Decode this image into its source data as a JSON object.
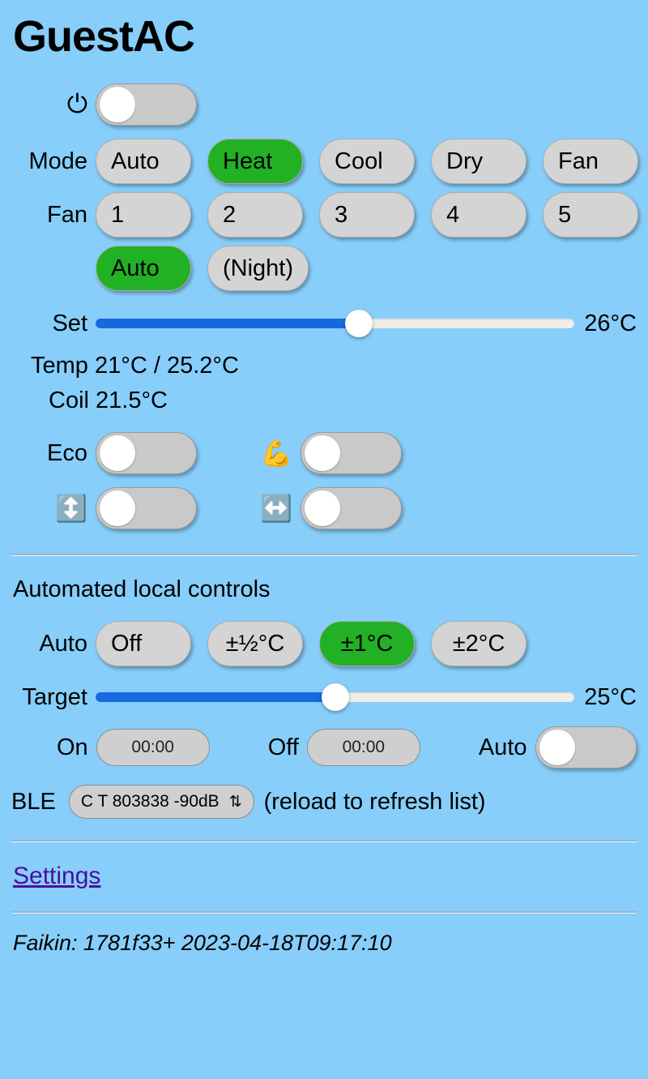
{
  "app": {
    "title": "GuestAC"
  },
  "power": {
    "icon": "power-icon",
    "glyph": "⏻",
    "state": "off"
  },
  "mode": {
    "label": "Mode",
    "options": [
      "Auto",
      "Heat",
      "Cool",
      "Dry",
      "Fan"
    ],
    "selected": "Heat"
  },
  "fan": {
    "label": "Fan",
    "speeds": [
      "1",
      "2",
      "3",
      "4",
      "5"
    ],
    "extra": [
      "Auto",
      "(Night)"
    ],
    "selected": "Auto"
  },
  "set_slider": {
    "label": "Set",
    "value": "26°C",
    "percent": 55
  },
  "readouts": {
    "temp": "Temp 21°C / 25.2°C",
    "coil": "Coil 21.5°C"
  },
  "toggles": {
    "eco": {
      "label": "Eco",
      "state": "off"
    },
    "powerful": {
      "label": "💪",
      "icon": "flexed-biceps-icon",
      "state": "off"
    },
    "swing_vertical": {
      "label": "↕️",
      "icon": "up-down-arrow-icon",
      "state": "off"
    },
    "swing_horizontal": {
      "label": "↔️",
      "icon": "left-right-arrow-icon",
      "state": "off"
    }
  },
  "automated": {
    "heading": "Automated local controls",
    "auto_label": "Auto",
    "auto_options": [
      "Off",
      "±½°C",
      "±1°C",
      "±2°C"
    ],
    "auto_selected": "±1°C",
    "target_slider": {
      "label": "Target",
      "value": "25°C",
      "percent": 50
    },
    "timer": {
      "on_label": "On",
      "on_value": "00:00",
      "off_label": "Off",
      "off_value": "00:00",
      "auto_label": "Auto",
      "auto_state": "off"
    }
  },
  "ble": {
    "label": "BLE",
    "selected": "C T 803838 -90dB",
    "chevron": "⇅",
    "note": "(reload to refresh list)"
  },
  "settings": {
    "link_label": "Settings"
  },
  "footer": {
    "text": "Faikin: 1781f33+ 2023-04-18T09:17:10"
  },
  "colors": {
    "background": "#87cefa",
    "selected_green": "#22b024",
    "button_gray": "#d4d4d4",
    "slider_blue": "#1769e0",
    "link_purple": "#4b0f9e"
  }
}
